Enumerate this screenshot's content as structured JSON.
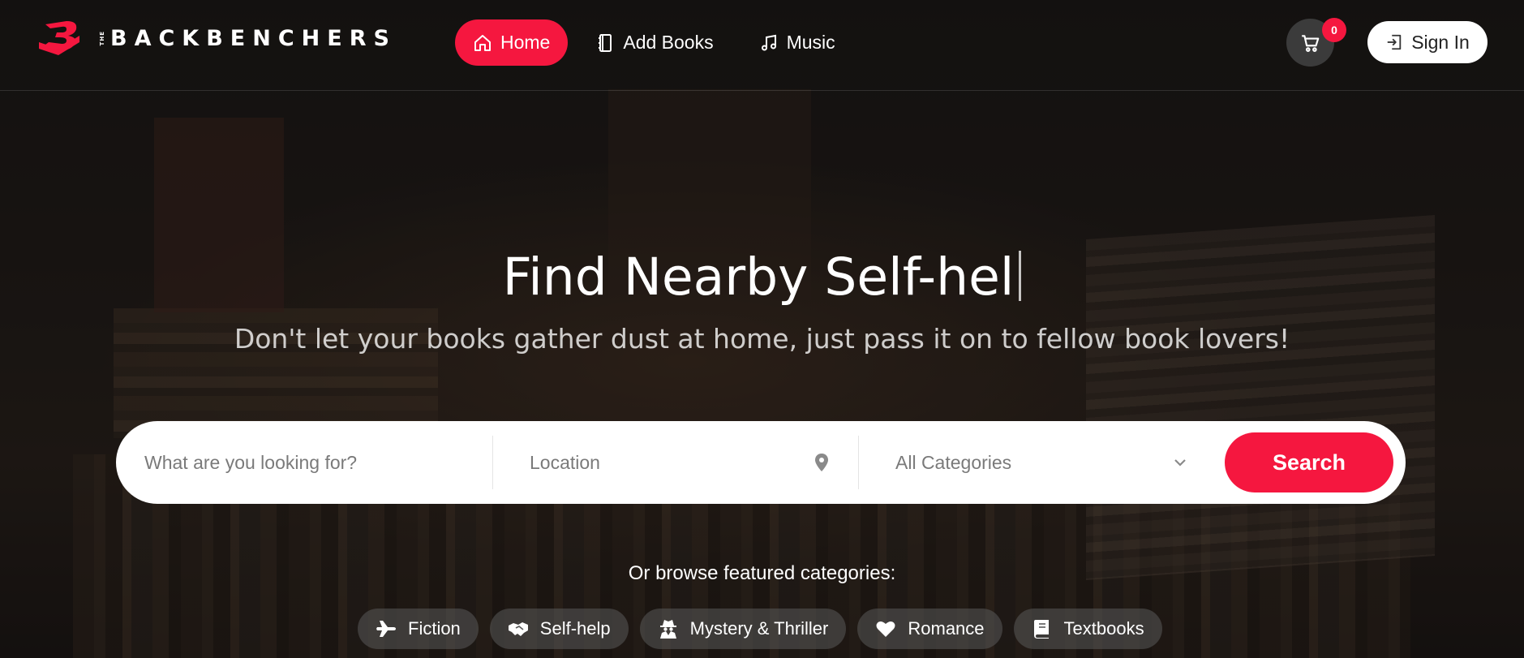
{
  "colors": {
    "accent": "#f5173f",
    "nav_bg": "#1d1a17",
    "badge": "#f5173f"
  },
  "brand": {
    "small_text": "THE",
    "name": "BACKBENCHERS",
    "logo_icon": "backbenchers-logo"
  },
  "nav": {
    "items": [
      {
        "label": "Home",
        "icon": "home-icon",
        "active": true
      },
      {
        "label": "Add Books",
        "icon": "notebook-icon",
        "active": false
      },
      {
        "label": "Music",
        "icon": "music-note-icon",
        "active": false
      }
    ]
  },
  "cart": {
    "icon": "cart-icon",
    "count": "0"
  },
  "signin": {
    "label": "Sign In",
    "icon": "sign-in-icon"
  },
  "hero": {
    "title": "Find Nearby Self-hel",
    "subtitle": "Don't let your books gather dust at home, just pass it on to fellow book lovers!"
  },
  "search": {
    "what_placeholder": "What are you looking for?",
    "location_placeholder": "Location",
    "category_selected": "All Categories",
    "button_label": "Search"
  },
  "categories": {
    "heading": "Or browse featured categories:",
    "items": [
      {
        "label": "Fiction",
        "icon": "plane-icon"
      },
      {
        "label": "Self-help",
        "icon": "handshake-icon"
      },
      {
        "label": "Mystery & Thriller",
        "icon": "user-secret-icon"
      },
      {
        "label": "Romance",
        "icon": "heart-icon"
      },
      {
        "label": "Textbooks",
        "icon": "book-icon"
      }
    ]
  }
}
